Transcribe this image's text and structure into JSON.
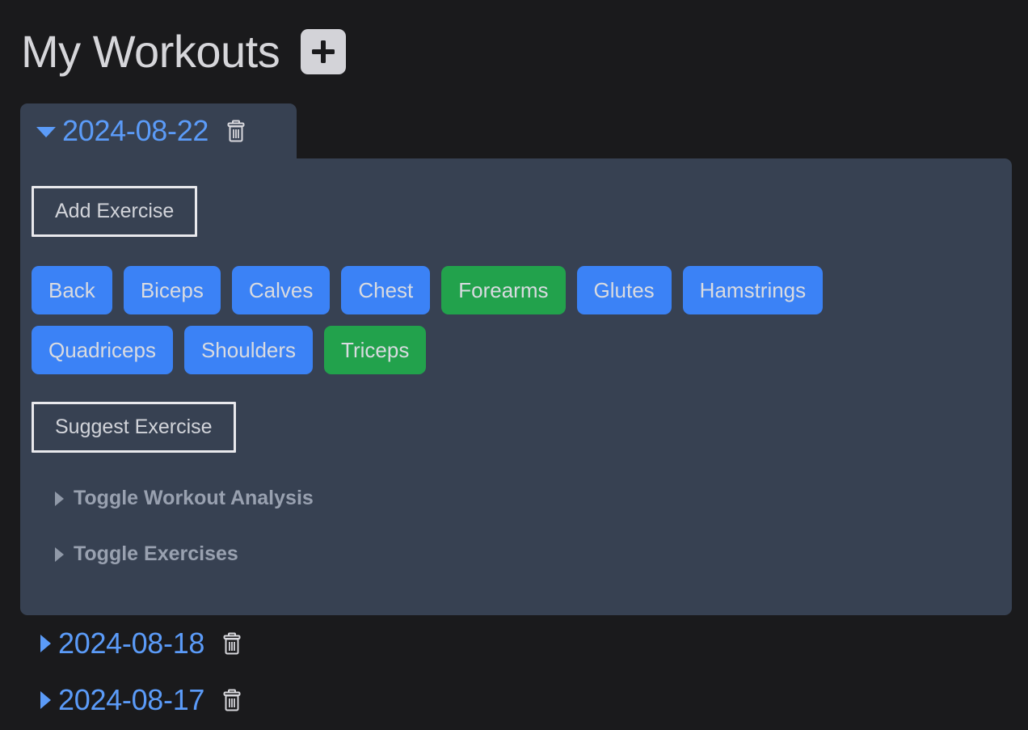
{
  "header": {
    "title": "My Workouts",
    "add_button_label": "+",
    "add_button_icon": "plus-icon"
  },
  "workouts": [
    {
      "date": "2024-08-22",
      "expanded": true,
      "toggle_icon": "chevron-down-icon",
      "delete_icon": "trash-icon",
      "add_exercise_label": "Add Exercise",
      "suggest_exercise_label": "Suggest Exercise",
      "muscle_tags": [
        {
          "label": "Back",
          "state": "default"
        },
        {
          "label": "Biceps",
          "state": "default"
        },
        {
          "label": "Calves",
          "state": "default"
        },
        {
          "label": "Chest",
          "state": "default"
        },
        {
          "label": "Forearms",
          "state": "selected"
        },
        {
          "label": "Glutes",
          "state": "default"
        },
        {
          "label": "Hamstrings",
          "state": "default"
        },
        {
          "label": "Quadriceps",
          "state": "default"
        },
        {
          "label": "Shoulders",
          "state": "default"
        },
        {
          "label": "Triceps",
          "state": "selected"
        }
      ],
      "toggles": [
        {
          "label": "Toggle Workout Analysis",
          "icon": "chevron-right-icon"
        },
        {
          "label": "Toggle Exercises",
          "icon": "chevron-right-icon"
        }
      ]
    },
    {
      "date": "2024-08-18",
      "expanded": false,
      "toggle_icon": "chevron-right-icon",
      "delete_icon": "trash-icon"
    },
    {
      "date": "2024-08-17",
      "expanded": false,
      "toggle_icon": "chevron-right-icon",
      "delete_icon": "trash-icon"
    }
  ],
  "colors": {
    "page_background": "#1a1a1c",
    "panel_background": "#374152",
    "accent_blue": "#5b9bf8",
    "tag_blue": "#3b82f6",
    "tag_green": "#22a24c",
    "title_text": "#d6d6da",
    "muted_text": "#99a1b0"
  }
}
